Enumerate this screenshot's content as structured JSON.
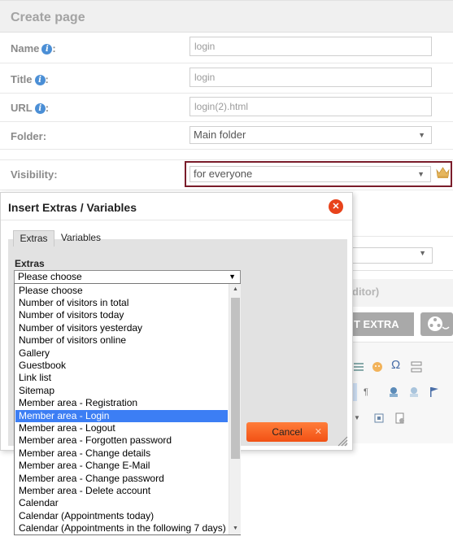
{
  "page": {
    "title": "Create page"
  },
  "form": {
    "name": {
      "label": "Name",
      "suffix": ":",
      "value": "login"
    },
    "title": {
      "label": "Title",
      "suffix": ":",
      "value": "login"
    },
    "url": {
      "label": "URL",
      "suffix": ":",
      "value": "login(2).html"
    },
    "folder": {
      "label": "Folder:",
      "value": "Main folder"
    },
    "visibility": {
      "label": "Visibility:",
      "value": "for everyone"
    }
  },
  "background": {
    "editor_text": "ditor)",
    "extra_button": "T EXTRA"
  },
  "dialog": {
    "title": "Insert Extras / Variables",
    "tabs": [
      "Extras",
      "Variables"
    ],
    "extras_label": "Extras",
    "extras_selected": "Please choose",
    "cancel_label": "Cancel",
    "options": [
      "Please choose",
      "Number of visitors in total",
      "Number of visitors today",
      "Number of visitors yesterday",
      "Number of visitors online",
      "Gallery",
      "Guestbook",
      "Link list",
      "Sitemap",
      "Member area - Registration",
      "Member area - Login",
      "Member area - Logout",
      "Member area - Forgotten password",
      "Member area - Change details",
      "Member area - Change E-Mail",
      "Member area - Change password",
      "Member area - Delete account",
      "Calendar",
      "Calendar (Appointments today)",
      "Calendar (Appointments in the following 7 days)"
    ],
    "highlighted_option": "Member area - Login"
  },
  "colors": {
    "accent": "#e8431b",
    "selection": "#3c7ef4",
    "highlight_border": "#7a1c2a",
    "info": "#4b8fd6"
  },
  "icons": [
    "info-icon",
    "crown-icon",
    "close-icon",
    "chevron-down-icon",
    "resize-grip-icon",
    "film-reel-icon"
  ]
}
